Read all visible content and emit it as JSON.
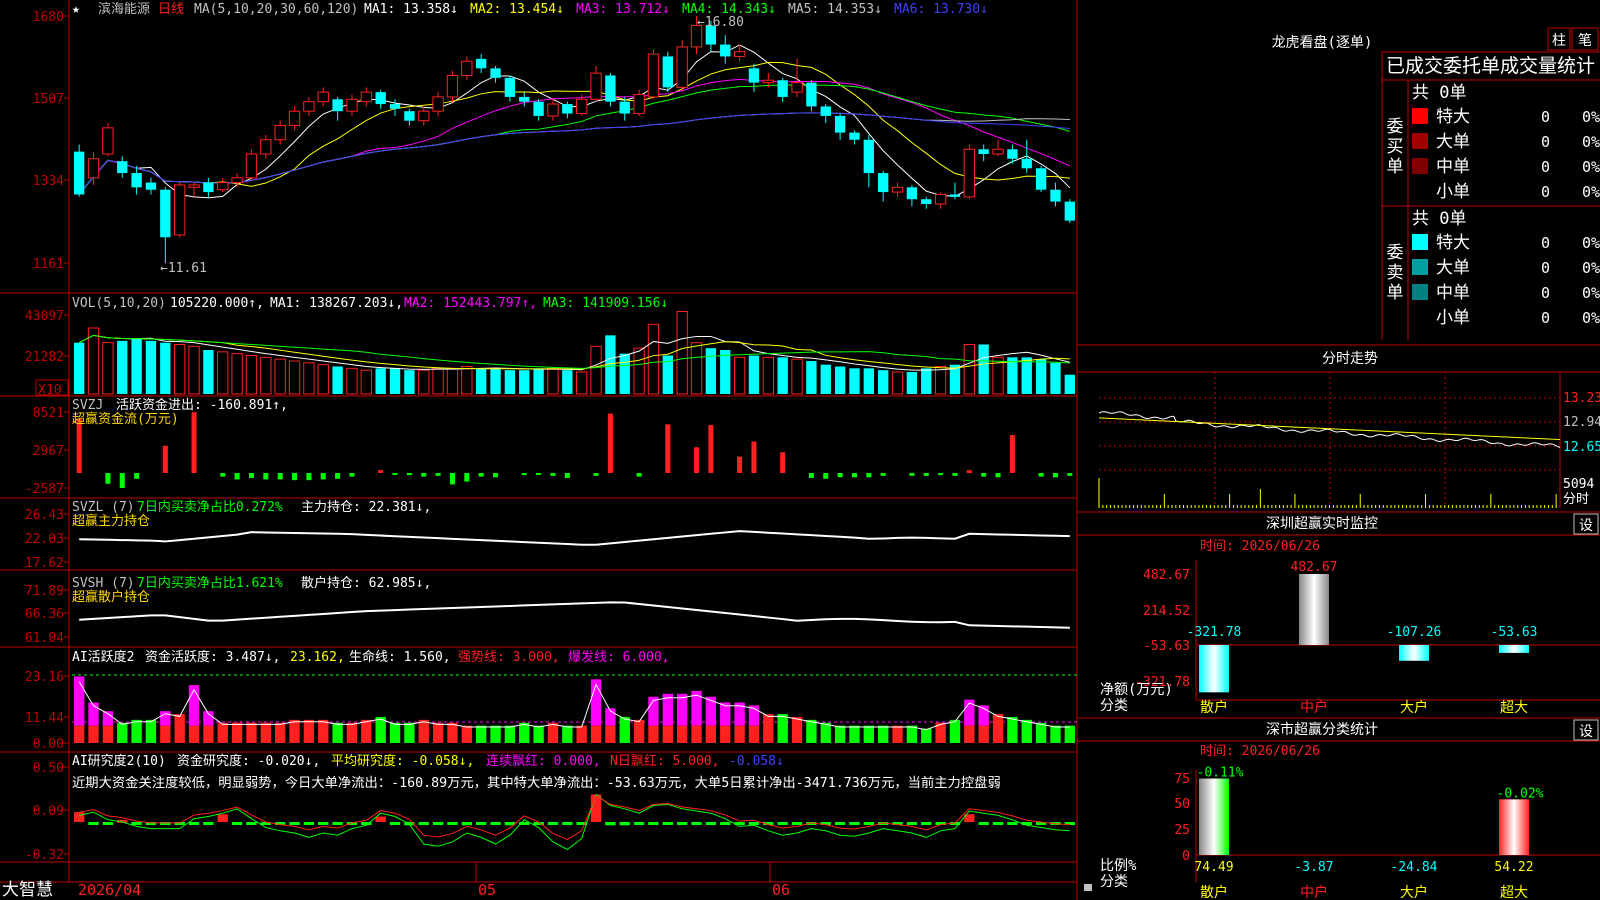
{
  "colors": {
    "up": "#ff2020",
    "down": "#00ffff",
    "axis_red": "#c00000",
    "white": "#ffffff",
    "yellow": "#ffff00",
    "magenta": "#ff00ff",
    "green": "#00ff00",
    "blue": "#4040ff",
    "gray": "#c0c0c0",
    "label_yellow": "#ffd700"
  },
  "main": {
    "star_icon": "★",
    "name": "滨海能源",
    "period": "日线",
    "ma_label": "MA(5,10,20,30,60,120)",
    "ma": [
      {
        "label": "MA1: 13.358↓",
        "color": "#ffffff"
      },
      {
        "label": "MA2: 13.454↓",
        "color": "#ffff00"
      },
      {
        "label": "MA3: 13.712↓",
        "color": "#ff00ff"
      },
      {
        "label": "MA4: 14.343↓",
        "color": "#00ff00"
      },
      {
        "label": "MA5: 14.353↓",
        "color": "#c0c0c0"
      },
      {
        "label": "MA6: 13.730↓",
        "color": "#4040ff"
      }
    ],
    "yticks": [
      "1680",
      "1507",
      "1334",
      "1161"
    ],
    "high_label": "16.80",
    "low_label": "11.61"
  },
  "vol": {
    "label": "VOL(5,10,20)",
    "value": "105220.000↑,",
    "ma": [
      {
        "label": "MA1: 138267.203↓,",
        "color": "#ffffff"
      },
      {
        "label": "MA2: 152443.797↑,",
        "color": "#ff00ff"
      },
      {
        "label": "MA3: 141909.156↓",
        "color": "#00ff00"
      }
    ],
    "yticks": [
      "43097",
      "21282"
    ],
    "unit": "X10"
  },
  "svzj": {
    "name": "SVZJ",
    "label": "活跃资金进出: -160.891↑,",
    "title": "超赢资金流(万元)",
    "yticks": [
      "8521",
      "2967",
      "-2587"
    ]
  },
  "svzl": {
    "name": "SVZL (7)",
    "ratio": "7日内买卖净占比0.272%",
    "hold": "主力持仓: 22.381↓,",
    "title": "超赢主力持仓",
    "yticks": [
      "26.43",
      "22.03",
      "17.62"
    ]
  },
  "svsh": {
    "name": "SVSH (7)",
    "ratio": "7日内买卖净占比1.621%",
    "hold": "散户持仓: 62.985↓,",
    "title": "超赢散户持仓",
    "yticks": [
      "71.89",
      "66.36",
      "61.04"
    ]
  },
  "ai1": {
    "name": "AI活跃度2",
    "a": "资金活跃度: 3.487↓,",
    "b": "23.162,",
    "c": "生命线: 1.560,",
    "d": "强势线: 3.000,",
    "e": "爆发线: 6.000,",
    "yticks": [
      "23.16",
      "11.44",
      "0.00"
    ]
  },
  "ai2": {
    "name": "AI研究度2(10)",
    "a": "资金研究度: -0.020↓,",
    "b": "平均研究度: -0.058↓,",
    "c": "连续飘红: 0.000,",
    "d": "N日飘红: 5.000,",
    "e": "-0.058↓",
    "note": "近期大资金关注度较低，明显弱势，今日大单净流出：-160.89万元，其中特大单净流出：-53.63万元，大单5日累计净出-3471.736万元，当前主力控盘弱",
    "yticks": [
      "0.50",
      "0.09",
      "-0.32"
    ]
  },
  "bottom": {
    "brand": "大智慧",
    "dates": [
      "2026/04",
      "05",
      "06"
    ]
  },
  "right": {
    "title": "龙虎看盘(逐单)",
    "btn_zhu": "柱",
    "btn_bi": "笔",
    "subtitle": "已成交委托单成交量统计",
    "buy": {
      "side_label": "委买单",
      "total": "共 0单",
      "rows": [
        {
          "name": "特大",
          "count": "0",
          "pct": "0%",
          "color": "#ff0000"
        },
        {
          "name": "大单",
          "count": "0",
          "pct": "0%",
          "color": "#a00000"
        },
        {
          "name": "中单",
          "count": "0",
          "pct": "0%",
          "color": "#800000"
        },
        {
          "name": "小单",
          "count": "0",
          "pct": "0%",
          "color": "#000000"
        }
      ]
    },
    "sell": {
      "side_label": "委卖单",
      "total": "共 0单",
      "rows": [
        {
          "name": "特大",
          "count": "0",
          "pct": "0%",
          "color": "#00ffff"
        },
        {
          "name": "大单",
          "count": "0",
          "pct": "0%",
          "color": "#00a0a0"
        },
        {
          "name": "中单",
          "count": "0",
          "pct": "0%",
          "color": "#008080"
        },
        {
          "name": "小单",
          "count": "0",
          "pct": "0%",
          "color": "#000000"
        }
      ]
    },
    "intraday": {
      "title": "分时走势",
      "yticks": [
        "13.23",
        "12.94",
        "12.65"
      ],
      "vol_label": "5094",
      "vol_unit": "分时"
    },
    "monitor": {
      "title": "深圳超赢实时监控",
      "set": "设",
      "time": "时间: 2026/06/26",
      "yticks": [
        "482.67",
        "214.52",
        "-53.63",
        "-321.78"
      ],
      "ylabel": "净额(万元)",
      "xlabel": "分类",
      "categories": [
        "散户",
        "中户",
        "大户",
        "超大"
      ],
      "values": [
        -321.78,
        482.67,
        -107.26,
        -53.63
      ],
      "value_labels": [
        "-321.78",
        "482.67",
        "-107.26",
        "-53.63"
      ]
    },
    "stats": {
      "title": "深市超赢分类统计",
      "set": "设",
      "time": "时间: 2026/06/26",
      "yticks": [
        "75",
        "50",
        "25",
        "0"
      ],
      "ylabel": "比例%",
      "xlabel": "分类",
      "categories": [
        "散户",
        "中户",
        "大户",
        "超大"
      ],
      "top_labels": [
        "-0.11%",
        "",
        "",
        "-0.02%"
      ],
      "values": [
        74.49,
        -3.87,
        -24.84,
        54.22
      ],
      "value_labels": [
        "74.49",
        "-3.87",
        "-24.84",
        "54.22"
      ]
    }
  },
  "chart_data": [
    {
      "type": "candlestick",
      "title": "滨海能源 日线",
      "ylim": [
        11.61,
        16.8
      ],
      "x": [
        "2026/04",
        "05",
        "06"
      ],
      "ohlc": [
        [
          13.95,
          13.05,
          14.1,
          13.0
        ],
        [
          13.4,
          13.8,
          13.95,
          13.25
        ],
        [
          13.9,
          14.45,
          14.55,
          13.85
        ],
        [
          13.75,
          13.5,
          13.85,
          13.4
        ],
        [
          13.5,
          13.2,
          13.65,
          13.05
        ],
        [
          13.3,
          13.15,
          13.4,
          13.05
        ],
        [
          13.15,
          12.15,
          13.2,
          11.61
        ],
        [
          12.2,
          13.25,
          13.3,
          12.15
        ],
        [
          13.2,
          13.25,
          13.3,
          13.0
        ],
        [
          13.3,
          13.1,
          13.4,
          13.0
        ],
        [
          13.15,
          13.3,
          13.4,
          13.1
        ],
        [
          13.3,
          13.4,
          13.5,
          13.2
        ],
        [
          13.4,
          13.9,
          14.0,
          13.35
        ],
        [
          13.9,
          14.2,
          14.3,
          13.8
        ],
        [
          14.2,
          14.5,
          14.6,
          14.1
        ],
        [
          14.5,
          14.8,
          14.9,
          14.4
        ],
        [
          14.8,
          15.0,
          15.1,
          14.7
        ],
        [
          15.0,
          15.2,
          15.3,
          14.9
        ],
        [
          15.05,
          14.8,
          15.1,
          14.6
        ],
        [
          14.8,
          15.05,
          15.15,
          14.7
        ],
        [
          15.0,
          15.2,
          15.3,
          14.9
        ],
        [
          15.2,
          14.95,
          15.25,
          14.85
        ],
        [
          14.95,
          14.85,
          15.05,
          14.7
        ],
        [
          14.8,
          14.6,
          14.85,
          14.5
        ],
        [
          14.6,
          14.8,
          14.9,
          14.5
        ],
        [
          14.8,
          15.1,
          15.2,
          14.7
        ],
        [
          15.1,
          15.55,
          15.65,
          15.0
        ],
        [
          15.55,
          15.85,
          15.95,
          15.45
        ],
        [
          15.9,
          15.7,
          16.0,
          15.6
        ],
        [
          15.7,
          15.5,
          15.75,
          15.4
        ],
        [
          15.5,
          15.1,
          15.55,
          15.0
        ],
        [
          15.1,
          15.0,
          15.2,
          14.9
        ],
        [
          15.0,
          14.7,
          15.05,
          14.6
        ],
        [
          14.7,
          14.95,
          15.05,
          14.6
        ],
        [
          14.95,
          14.75,
          15.0,
          14.65
        ],
        [
          14.75,
          15.05,
          15.15,
          14.7
        ],
        [
          15.05,
          15.6,
          15.75,
          15.0
        ],
        [
          15.55,
          15.0,
          15.6,
          14.9
        ],
        [
          15.0,
          14.75,
          15.1,
          14.6
        ],
        [
          14.75,
          15.15,
          15.25,
          14.7
        ],
        [
          15.1,
          16.0,
          16.1,
          15.05
        ],
        [
          15.95,
          15.3,
          16.05,
          15.2
        ],
        [
          15.3,
          16.15,
          16.3,
          15.2
        ],
        [
          16.15,
          16.6,
          16.8,
          16.0
        ],
        [
          16.6,
          16.2,
          16.7,
          16.05
        ],
        [
          16.2,
          15.95,
          16.4,
          15.8
        ],
        [
          15.95,
          16.05,
          16.2,
          15.85
        ],
        [
          15.7,
          15.4,
          15.8,
          15.2
        ],
        [
          15.4,
          15.45,
          15.6,
          15.3
        ],
        [
          15.45,
          15.1,
          15.5,
          15.0
        ],
        [
          15.2,
          15.4,
          15.9,
          15.1
        ],
        [
          15.4,
          14.9,
          15.45,
          14.8
        ],
        [
          14.9,
          14.7,
          14.95,
          14.55
        ],
        [
          14.7,
          14.35,
          14.75,
          14.2
        ],
        [
          14.35,
          14.2,
          14.4,
          14.1
        ],
        [
          14.2,
          13.5,
          14.3,
          13.2
        ],
        [
          13.5,
          13.1,
          13.55,
          12.9
        ],
        [
          13.1,
          13.2,
          13.3,
          13.0
        ],
        [
          13.2,
          12.95,
          13.25,
          12.8
        ],
        [
          12.95,
          12.85,
          13.0,
          12.75
        ],
        [
          12.85,
          13.05,
          13.1,
          12.75
        ],
        [
          13.05,
          13.0,
          13.3,
          12.95
        ],
        [
          13.0,
          14.0,
          14.1,
          12.95
        ],
        [
          14.0,
          13.9,
          14.1,
          13.75
        ],
        [
          13.9,
          14.0,
          14.2,
          13.85
        ],
        [
          14.0,
          13.8,
          14.1,
          13.7
        ],
        [
          13.8,
          13.6,
          14.2,
          13.5
        ],
        [
          13.6,
          13.15,
          13.65,
          13.1
        ],
        [
          13.15,
          12.9,
          13.3,
          12.8
        ],
        [
          12.9,
          12.5,
          12.95,
          12.45
        ]
      ]
    },
    {
      "type": "bar",
      "title": "VOL(5,10,20)",
      "ylim": [
        0,
        43097
      ],
      "values": [
        28000,
        36000,
        28000,
        29000,
        30000,
        29000,
        28000,
        27000,
        26000,
        24000,
        23000,
        22000,
        21000,
        20000,
        19000,
        18000,
        17000,
        16000,
        15000,
        14000,
        13000,
        14000,
        14000,
        13000,
        13000,
        14000,
        14000,
        15000,
        14000,
        14000,
        13000,
        13000,
        14000,
        14000,
        13000,
        12000,
        26000,
        32000,
        22000,
        25000,
        38000,
        21000,
        45000,
        28000,
        25000,
        24000,
        20000,
        21000,
        20000,
        20000,
        19000,
        18000,
        16000,
        15000,
        14000,
        14000,
        13000,
        12000,
        12000,
        14000,
        15000,
        16000,
        27000,
        27000,
        20000,
        20000,
        20000,
        19000,
        17000,
        10522
      ]
    },
    {
      "type": "bar",
      "title": "超赢资金流(万元)",
      "ylim": [
        -2587,
        8521
      ],
      "values": [
        7600,
        0,
        -1500,
        -2100,
        -800,
        0,
        3800,
        0,
        8500,
        0,
        -500,
        -900,
        -700,
        -900,
        -900,
        -1000,
        -1000,
        -900,
        -800,
        -500,
        0,
        400,
        -200,
        -300,
        -500,
        -400,
        -1600,
        -1200,
        -500,
        -600,
        0,
        -300,
        -200,
        -400,
        -700,
        0,
        -400,
        8300,
        0,
        -500,
        0,
        6800,
        0,
        3600,
        6700,
        0,
        2300,
        4400,
        0,
        2900,
        0,
        -700,
        -800,
        -600,
        -600,
        -600,
        -400,
        0,
        -400,
        -400,
        -300,
        -400,
        400,
        -500,
        -600,
        5300,
        0,
        -500,
        -600,
        -400,
        -400,
        -500,
        -900,
        -600,
        -400
      ]
    }
  ]
}
